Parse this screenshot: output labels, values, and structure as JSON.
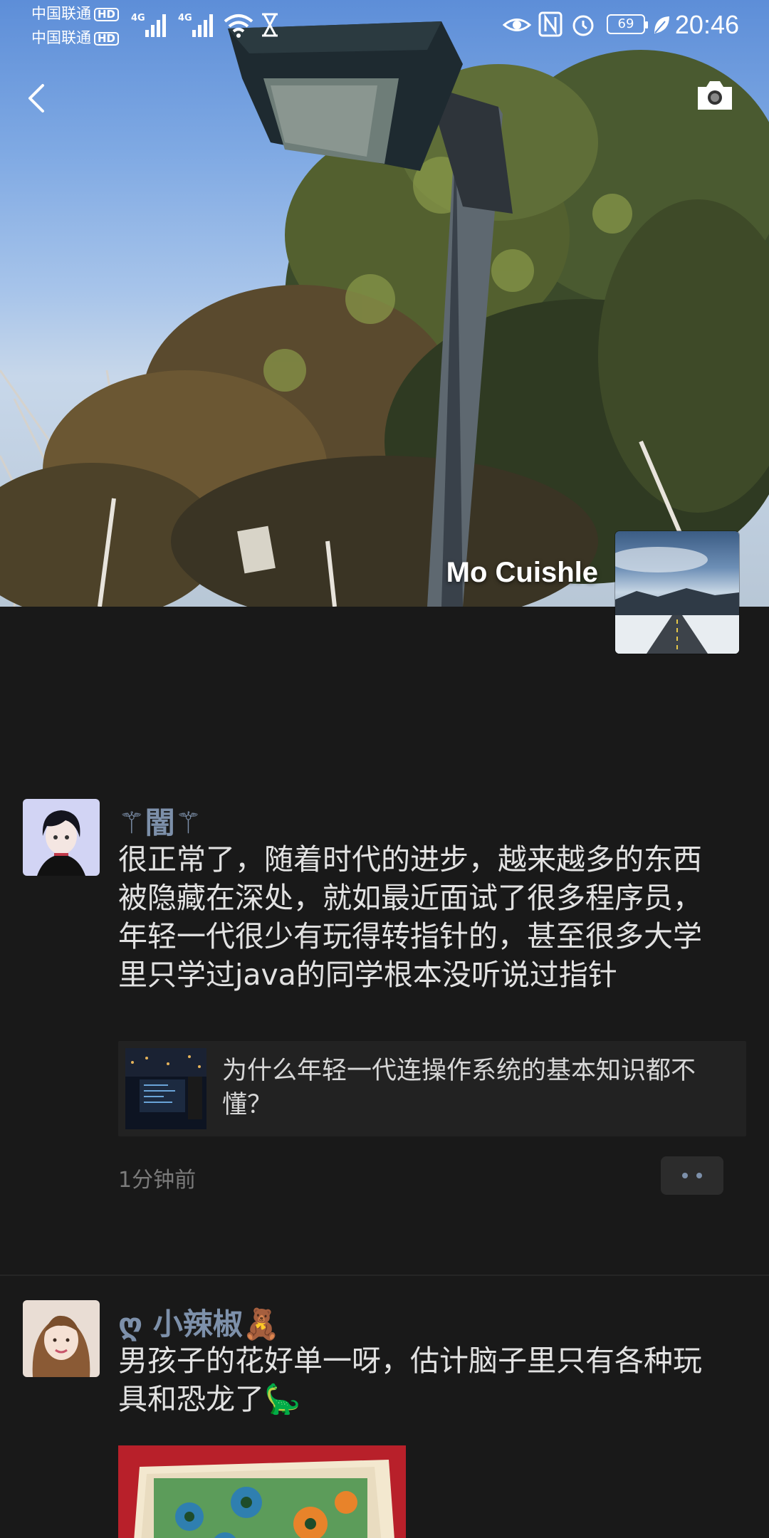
{
  "status_bar": {
    "carrier_1": "中国联通",
    "carrier_2": "中国联通",
    "hd_badge": "HD",
    "network_1": "4G",
    "network_2": "4G",
    "battery": "69",
    "time": "20:46",
    "icons": [
      "signal-icon",
      "signal-icon",
      "wifi-icon",
      "hourglass-icon",
      "eye-icon",
      "nfc-icon",
      "alarm-icon",
      "battery-icon",
      "leaf-icon"
    ]
  },
  "header": {
    "back_icon": "back-arrow-icon",
    "camera_icon": "camera-icon"
  },
  "profile": {
    "username": "Mo Cuishle"
  },
  "posts": [
    {
      "name": "⚚闇⚚",
      "text": "很正常了，随着时代的进步，越来越多的东西被隐藏在深处，就如最近面试了很多程序员，年轻一代很少有玩得转指针的，甚至很多大学里只学过java的同学根本没听说过指针",
      "link_title": "为什么年轻一代连操作系统的基本知识都不懂？",
      "time": "1分钟前"
    },
    {
      "name": "ღ 小辣椒🧸",
      "text": "男孩子的花好单一呀，估计脑子里只有各种玩具和恐龙了🦕"
    }
  ],
  "colors": {
    "background": "#191919",
    "name_accent": "#7d90aa",
    "card_bg": "#222222"
  }
}
